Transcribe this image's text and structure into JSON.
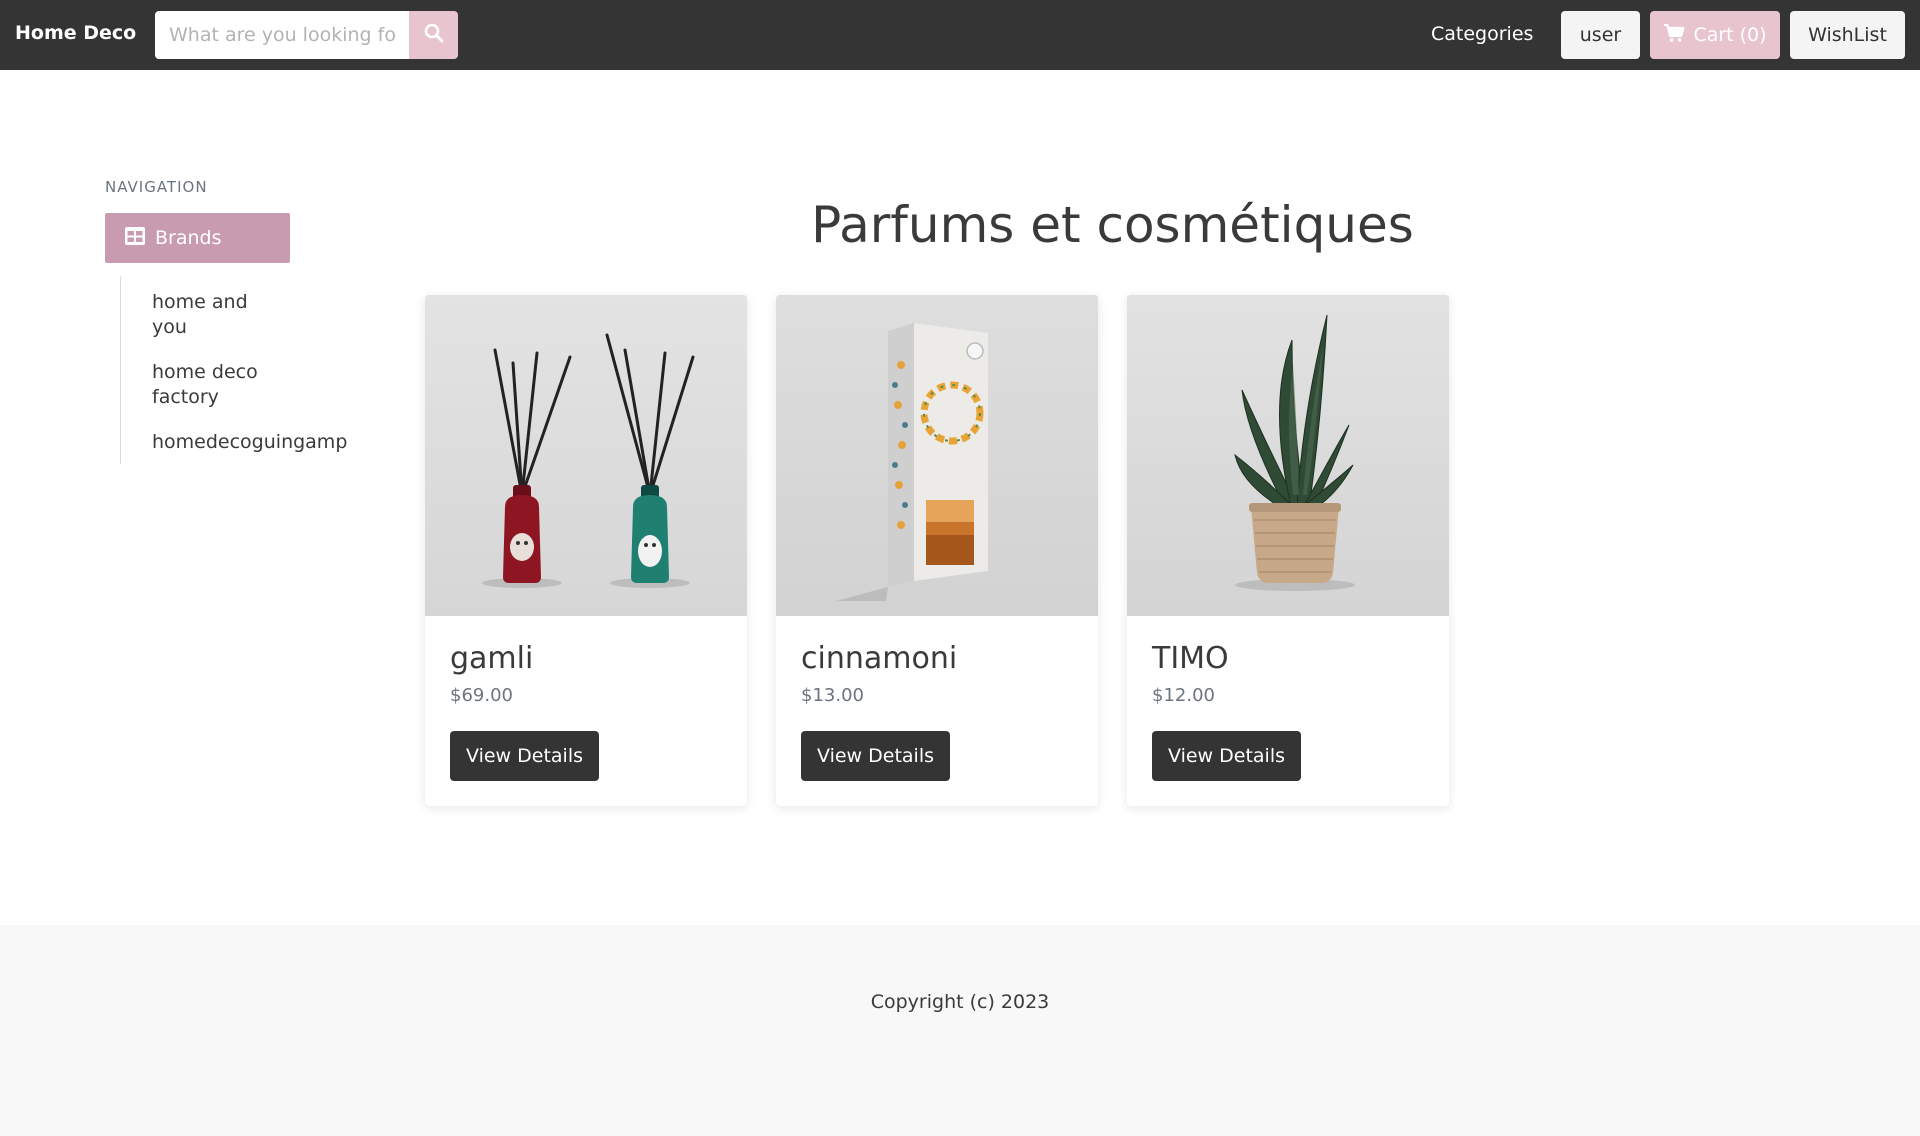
{
  "navbar": {
    "brand": "Home Deco",
    "search_placeholder": "What are you looking for?",
    "categories_label": "Categories",
    "user_label": "user",
    "cart_label": "Cart (0)",
    "wishlist_label": "WishList",
    "accent_color": "#e8c4cf"
  },
  "sidebar": {
    "heading": "NAVIGATION",
    "brands_label": "Brands",
    "items": [
      {
        "label": "home and you"
      },
      {
        "label": "home deco factory"
      },
      {
        "label": "homedecoguingamp"
      }
    ]
  },
  "main": {
    "title": "Parfums et cosmétiques",
    "products": [
      {
        "name": "gamli",
        "price": "$69.00",
        "button": "View Details",
        "image": "reed-diffuser-pair"
      },
      {
        "name": "cinnamoni",
        "price": "$13.00",
        "button": "View Details",
        "image": "boxed-diffuser"
      },
      {
        "name": "TIMO",
        "price": "$12.00",
        "button": "View Details",
        "image": "potted-snake-plant"
      }
    ]
  },
  "footer": {
    "copyright": "Copyright (c) 2023"
  }
}
